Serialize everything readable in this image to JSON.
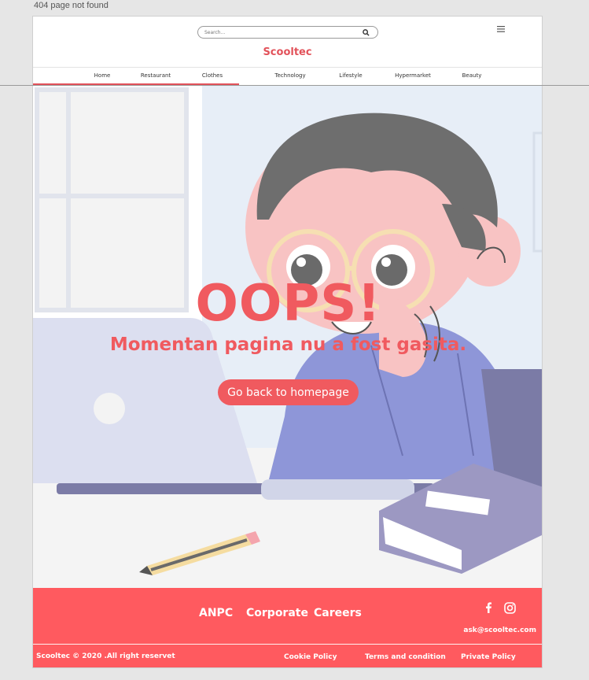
{
  "canvas": {
    "label": "404 page not found"
  },
  "header": {
    "search_placeholder": "Search...",
    "brand": "Scooltec",
    "nav": [
      "Home",
      "Restaurant",
      "Clothes",
      "Technology",
      "Lifestyle",
      "Hypermarket",
      "Beauty"
    ]
  },
  "hero": {
    "title": "OOPS!",
    "subtitle": "Momentan pagina nu a fost gasita.",
    "button_label": "Go back to homepage"
  },
  "footer": {
    "links": [
      "ANPC",
      "Corporate",
      "Careers"
    ],
    "email": "ask@scooltec.com",
    "copyright": "Scooltec © 2020 .All right reservet",
    "legal": [
      "Cookie Policy",
      "Terms and condition",
      "Private Policy"
    ]
  },
  "colors": {
    "accent": "#f05a5f",
    "footer": "#ff5a5f",
    "brand": "#e2525a"
  },
  "icons": [
    "search-icon",
    "menu-icon",
    "facebook-icon",
    "instagram-icon"
  ]
}
